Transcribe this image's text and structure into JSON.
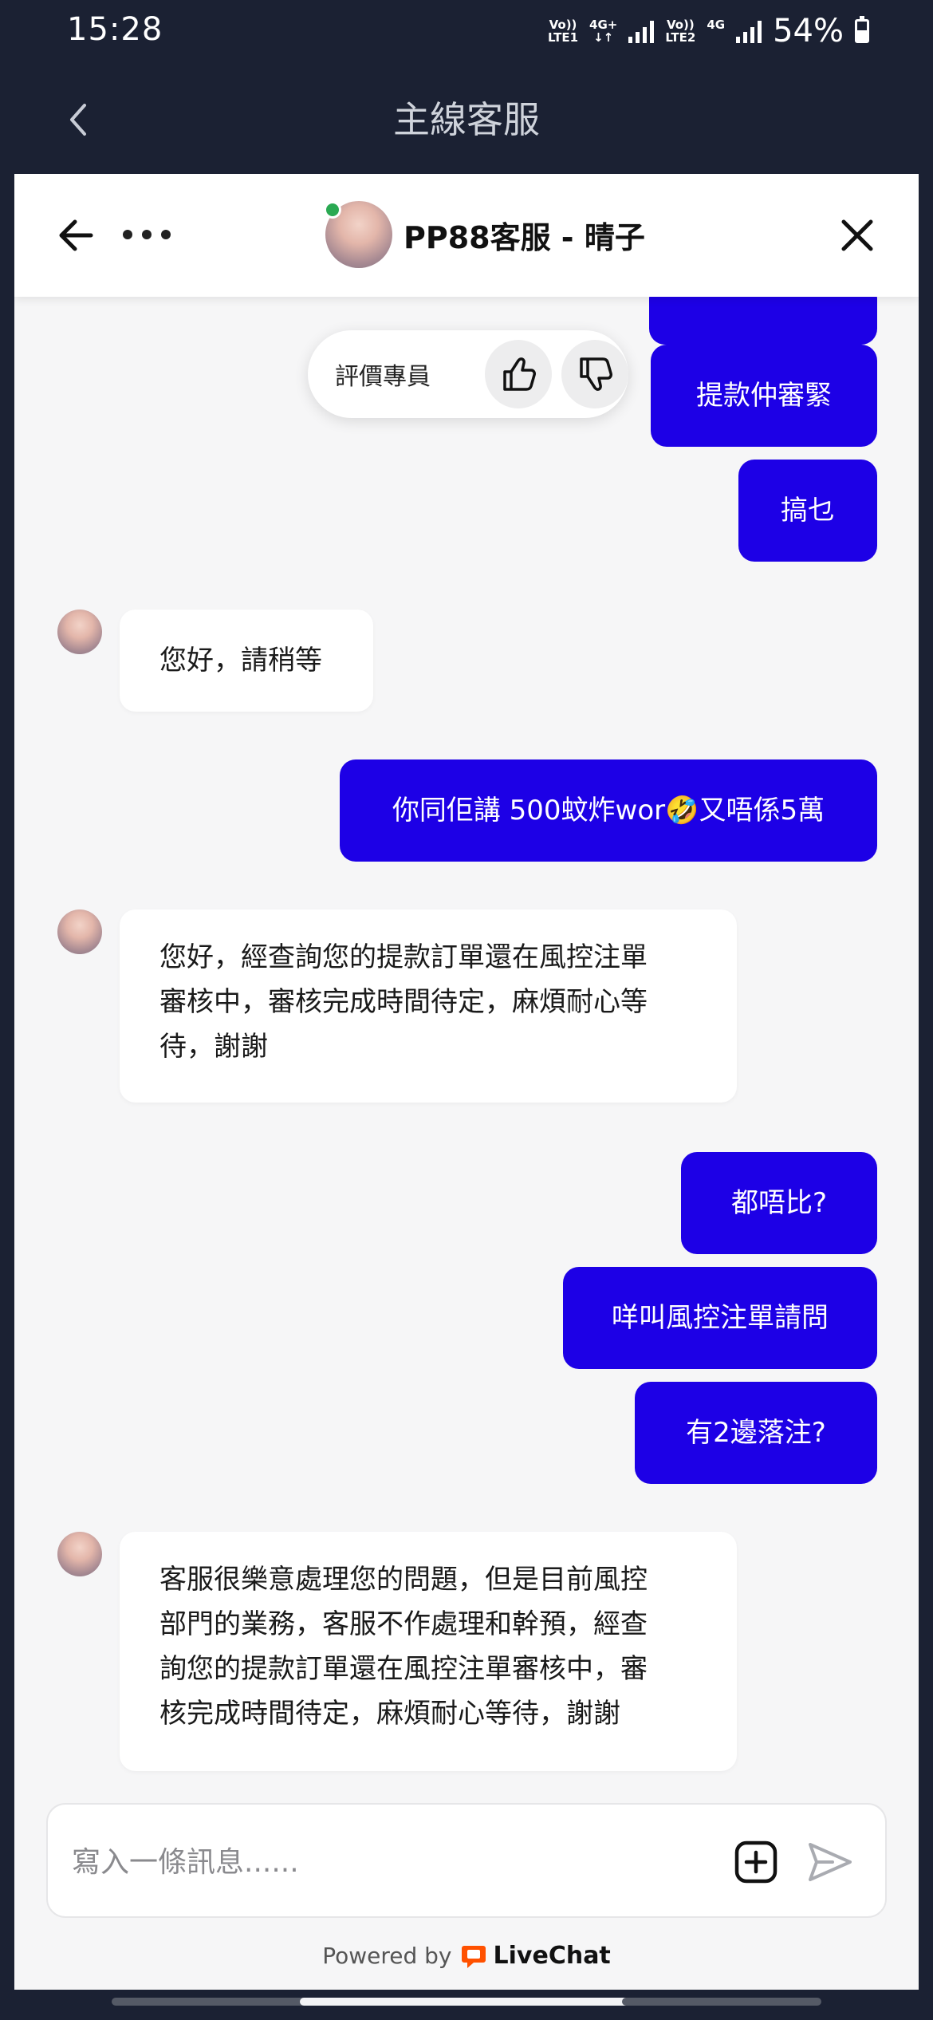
{
  "status_bar": {
    "time": "15:28",
    "sim1_top": "Vo))",
    "sim1_bottom": "LTE1",
    "sim1_net": "4G+",
    "sim2_top": "Vo))",
    "sim2_bottom": "LTE2",
    "sim2_net": "4G",
    "battery": "54%",
    "battery_level": 0.54
  },
  "outer_header": {
    "title": "主線客服",
    "back_icon": "chevron-left-icon"
  },
  "chat_header": {
    "agent_name": "PP88客服 - 晴子",
    "online": true,
    "icons": [
      "arrow-left-icon",
      "more-dots-icon",
      "close-icon"
    ]
  },
  "rating": {
    "label": "評價專員",
    "icons": [
      "thumbs-up-icon",
      "thumbs-down-icon"
    ]
  },
  "messages": [
    {
      "from": "me",
      "text": "提款仲審緊"
    },
    {
      "from": "me",
      "text": "搞乜"
    },
    {
      "from": "agent",
      "text": "您好，請稍等"
    },
    {
      "from": "me",
      "text": "你同佢講 500蚊炸wor🤣又唔係5萬"
    },
    {
      "from": "agent",
      "lines": [
        "您好，經查詢您的提款訂單還在風控注單",
        "審核中，審核完成時間待定，麻煩耐心等",
        "待，謝謝"
      ]
    },
    {
      "from": "me",
      "text": "都唔比?"
    },
    {
      "from": "me",
      "text": "咩叫風控注單請問"
    },
    {
      "from": "me",
      "text": "有2邊落注?"
    },
    {
      "from": "agent",
      "lines": [
        "客服很樂意處理您的問題，但是目前風控",
        "部門的業務，客服不作處理和幹預，經查",
        "詢您的提款訂單還在風控注單審核中，審",
        "核完成時間待定，麻煩耐心等待，謝謝"
      ]
    }
  ],
  "composer": {
    "placeholder": "寫入一條訊息......",
    "icons": [
      "add-attachment-icon",
      "send-icon"
    ]
  },
  "footer": {
    "powered_by": "Powered by",
    "brand": "LiveChat"
  },
  "colors": {
    "my_bubble": "#1d00e6",
    "agent_bubble": "#ffffff",
    "app_bar": "#1b2133",
    "chat_bg": "#f6f6f7",
    "online": "#2aa952",
    "livechat_brand": "#ff5100"
  }
}
